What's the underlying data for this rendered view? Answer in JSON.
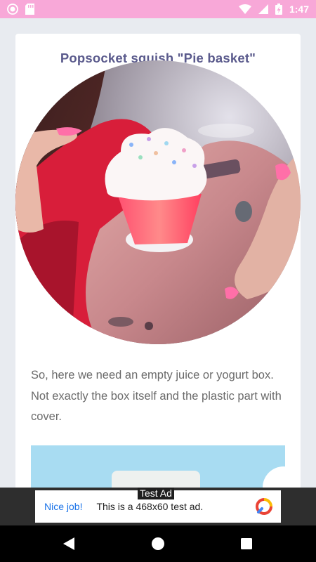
{
  "status_bar": {
    "time": "1:47",
    "icons": [
      "record-icon",
      "sd-card-icon",
      "wifi-icon",
      "signal-icon",
      "battery-charging-icon"
    ]
  },
  "article": {
    "title": "Popsocket squish \"Pie basket\"",
    "body": "So, here we need an empty juice or yogurt box. Not exactly the box itself and the plastic part with cover."
  },
  "ad": {
    "tag": "Test Ad",
    "headline": "Nice job!",
    "text": "This is a 468x60 test ad.",
    "icon": "ad-choices-logo-icon"
  },
  "nav": {
    "icons": [
      "back-icon",
      "home-icon",
      "recents-icon"
    ]
  },
  "colors": {
    "status_bar": "#f8a8d8",
    "title": "#5a5a8c",
    "body_text": "#6a6a6a",
    "ad_link": "#1a73e8",
    "background": "#e8ebf0"
  }
}
